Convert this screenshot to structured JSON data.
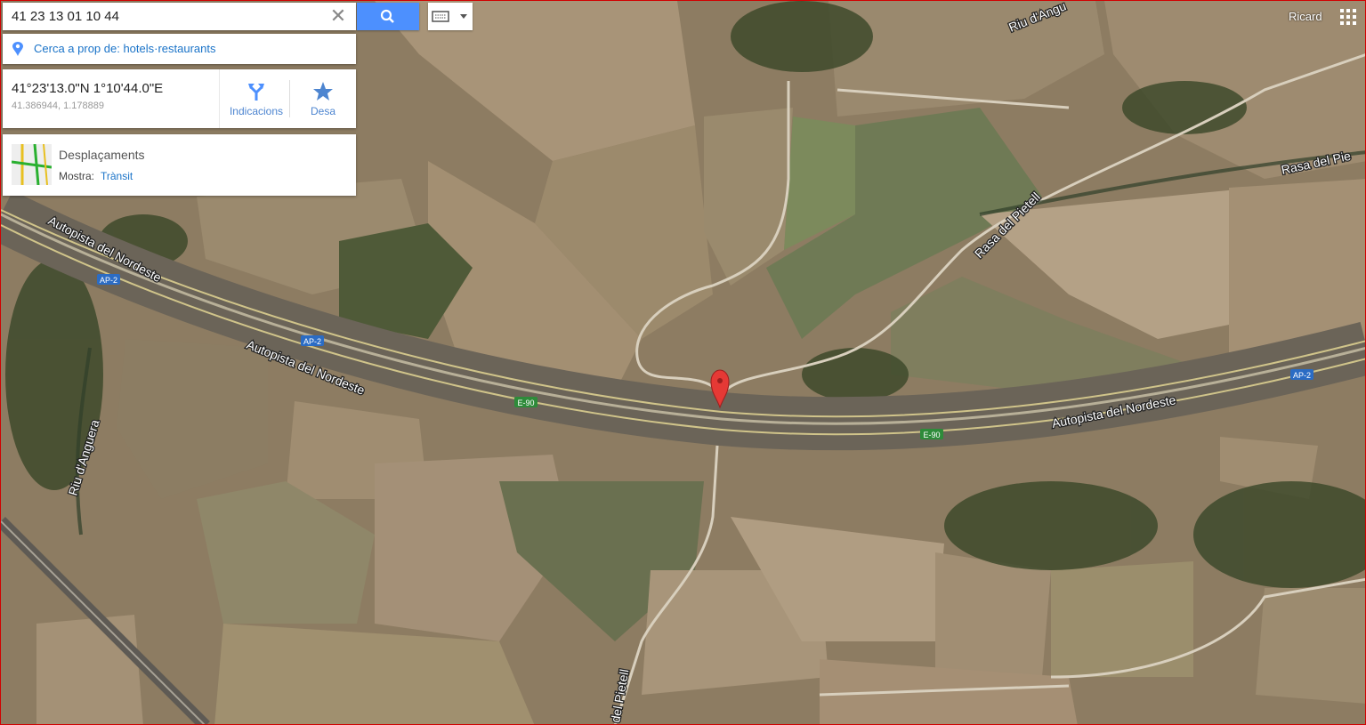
{
  "search": {
    "value": "41 23 13 01 10 44"
  },
  "nearby": {
    "label": "Cerca a prop de: hotels·restaurants"
  },
  "coordinates": {
    "dms": "41°23'13.0\"N 1°10'44.0\"E",
    "decimal": "41.386944, 1.178889"
  },
  "actions": {
    "directions": "Indicacions",
    "save": "Desa"
  },
  "traffic": {
    "title": "Desplaçaments",
    "show_label": "Mostra:",
    "layer": "Trànsit"
  },
  "user": {
    "name": "Ricard"
  },
  "map_labels": {
    "highway_name": "Autopista del Nordeste",
    "ap2": "AP-2",
    "e90": "E-90",
    "stream_pietell": "Rasa del Pietell",
    "stream_pietell_cut": "Rasa del Pie",
    "river_anguera": "Riu d'Anguera",
    "river_top": "Riu d'Angu",
    "road_pietell": "del Pietell"
  },
  "colors": {
    "search_blue": "#4d90fe",
    "link_blue": "#1a73c8",
    "pin_red": "#e53935",
    "shield_blue": "#2b6cc4",
    "shield_green": "#2e8b3a"
  }
}
